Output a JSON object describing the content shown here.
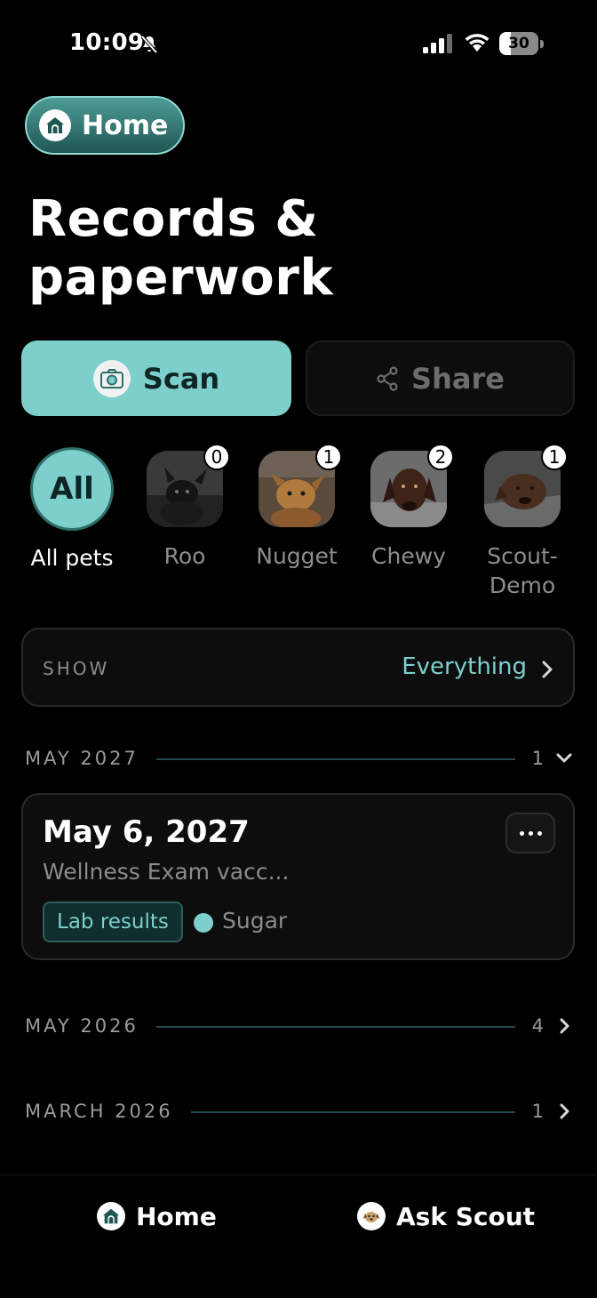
{
  "status_bar": {
    "time": "10:09",
    "battery_level": "30",
    "battery_fraction": 0.3
  },
  "header": {
    "home_label": "Home",
    "title": "Records & paperwork"
  },
  "actions": {
    "scan_label": "Scan",
    "share_label": "Share"
  },
  "pets": {
    "all": {
      "avatar_text": "All",
      "label": "All pets"
    },
    "items": [
      {
        "name": "Roo",
        "count": "0"
      },
      {
        "name": "Nugget",
        "count": "1"
      },
      {
        "name": "Chewy",
        "count": "2"
      },
      {
        "name": "Scout-Demo",
        "count": "1"
      }
    ]
  },
  "filter": {
    "label": "SHOW",
    "value": "Everything"
  },
  "timeline": [
    {
      "month": "MAY 2027",
      "count": "1",
      "expanded": true,
      "records": [
        {
          "date": "May 6, 2027",
          "description": "Wellness Exam vacc...",
          "tag": "Lab results",
          "pet": "Sugar"
        }
      ]
    },
    {
      "month": "MAY 2026",
      "count": "4",
      "expanded": false
    },
    {
      "month": "MARCH 2026",
      "count": "1",
      "expanded": false
    }
  ],
  "tab_bar": {
    "home_label": "Home",
    "ask_label": "Ask Scout"
  },
  "colors": {
    "accent": "#7ccfcb",
    "background": "#000000",
    "card": "#0d0d0d"
  }
}
